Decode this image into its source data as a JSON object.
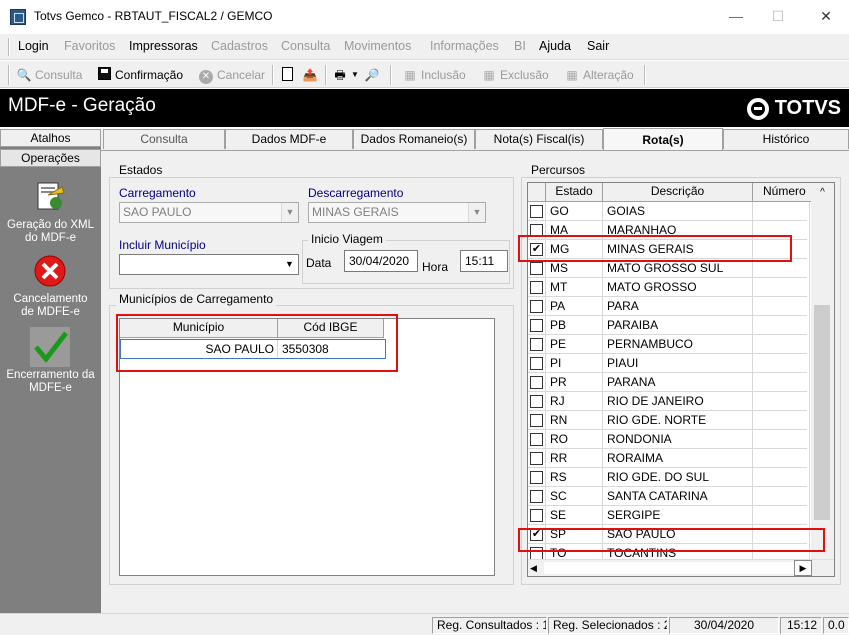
{
  "window": {
    "title": "Totvs Gemco - RBTAUT_FISCAL2 / GEMCO",
    "minimize": "—",
    "maximize": "☐",
    "close": "✕"
  },
  "menu": [
    "Login",
    "Favoritos",
    "Impressoras",
    "Cadastros",
    "Consulta",
    "Movimentos",
    "Informações",
    "BI",
    "Ajuda",
    "Sair"
  ],
  "toolbar": {
    "consulta": "Consulta",
    "confirmacao": "Confirmação",
    "cancelar": "Cancelar",
    "inclusao": "Inclusão",
    "exclusao": "Exclusão",
    "alteracao": "Alteração"
  },
  "header": {
    "title": "MDF-e - Geração",
    "logo": "TOTVS"
  },
  "sidebar": {
    "tab_atalhos": "Atalhos",
    "tab_operacoes": "Operações",
    "items": [
      {
        "line1": "Geração do XML",
        "line2": "do MDF-e"
      },
      {
        "line1": "Cancelamento",
        "line2": "de MDFE-e"
      },
      {
        "line1": "Encerramento da",
        "line2": "MDFE-e"
      }
    ]
  },
  "tabs": [
    "Consulta",
    "Dados MDF-e",
    "Dados Romaneio(s)",
    "Nota(s) Fiscal(is)",
    "Rota(s)",
    "Histórico"
  ],
  "estados": {
    "group": "Estados",
    "carregamento_label": "Carregamento",
    "carregamento_value": "SAO PAULO",
    "descarregamento_label": "Descarregamento",
    "descarregamento_value": "MINAS GERAIS",
    "incluir_label": "Incluir Município",
    "incluir_value": "",
    "inicio_group": "Inicio Viagem",
    "data_label": "Data",
    "data_value": "30/04/2020",
    "hora_label": "Hora",
    "hora_value": "15:11"
  },
  "municipios": {
    "group": "Municípios de Carregamento",
    "col_municipio": "Município",
    "col_ibge": "Cód IBGE",
    "rows": [
      {
        "municipio": "SAO PAULO",
        "ibge": "3550308"
      }
    ]
  },
  "percursos": {
    "group": "Percursos",
    "col_estado": "Estado",
    "col_descricao": "Descrição",
    "col_numero": "Número",
    "rows": [
      {
        "uf": "GO",
        "desc": "GOIAS",
        "checked": ""
      },
      {
        "uf": "MA",
        "desc": "MARANHAO",
        "checked": ""
      },
      {
        "uf": "MG",
        "desc": "MINAS GERAIS",
        "checked": "✔"
      },
      {
        "uf": "MS",
        "desc": "MATO GROSSO SUL",
        "checked": ""
      },
      {
        "uf": "MT",
        "desc": "MATO GROSSO",
        "checked": ""
      },
      {
        "uf": "PA",
        "desc": "PARA",
        "checked": ""
      },
      {
        "uf": "PB",
        "desc": "PARAIBA",
        "checked": ""
      },
      {
        "uf": "PE",
        "desc": "PERNAMBUCO",
        "checked": ""
      },
      {
        "uf": "PI",
        "desc": "PIAUI",
        "checked": ""
      },
      {
        "uf": "PR",
        "desc": "PARANA",
        "checked": ""
      },
      {
        "uf": "RJ",
        "desc": "RIO DE JANEIRO",
        "checked": ""
      },
      {
        "uf": "RN",
        "desc": "RIO GDE. NORTE",
        "checked": ""
      },
      {
        "uf": "RO",
        "desc": "RONDONIA",
        "checked": ""
      },
      {
        "uf": "RR",
        "desc": "RORAIMA",
        "checked": ""
      },
      {
        "uf": "RS",
        "desc": "RIO GDE. DO SUL",
        "checked": ""
      },
      {
        "uf": "SC",
        "desc": "SANTA CATARINA",
        "checked": ""
      },
      {
        "uf": "SE",
        "desc": "SERGIPE",
        "checked": ""
      },
      {
        "uf": "SP",
        "desc": "SAO PAULO",
        "checked": "✔"
      },
      {
        "uf": "TO",
        "desc": "TOCANTINS",
        "checked": ""
      }
    ]
  },
  "status": {
    "consultados": "Reg. Consultados : 1",
    "selecionados": "Reg. Selecionados : 2",
    "date": "30/04/2020",
    "time": "15:12",
    "extra": "0.0"
  },
  "colors": {
    "highlight": "#e01010",
    "header_bg": "#000000",
    "sidebar_bg": "#7f7f7f"
  }
}
